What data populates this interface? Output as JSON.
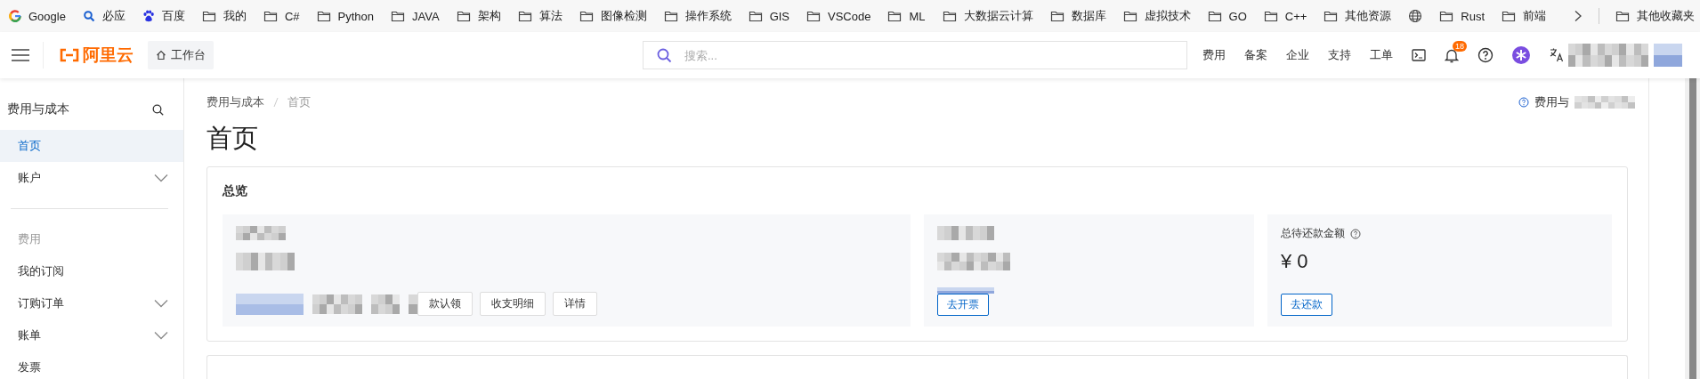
{
  "bookmarks": [
    {
      "label": "Google",
      "kind": "google"
    },
    {
      "label": "必应",
      "kind": "search"
    },
    {
      "label": "百度",
      "kind": "paw"
    },
    {
      "label": "我的",
      "kind": "folder"
    },
    {
      "label": "C#",
      "kind": "folder"
    },
    {
      "label": "Python",
      "kind": "folder"
    },
    {
      "label": "JAVA",
      "kind": "folder"
    },
    {
      "label": "架构",
      "kind": "folder"
    },
    {
      "label": "算法",
      "kind": "folder"
    },
    {
      "label": "图像检测",
      "kind": "folder"
    },
    {
      "label": "操作系统",
      "kind": "folder"
    },
    {
      "label": "GIS",
      "kind": "folder"
    },
    {
      "label": "VSCode",
      "kind": "folder"
    },
    {
      "label": "ML",
      "kind": "folder"
    },
    {
      "label": "大数据云计算",
      "kind": "folder"
    },
    {
      "label": "数据库",
      "kind": "folder"
    },
    {
      "label": "虚拟技术",
      "kind": "folder"
    },
    {
      "label": "GO",
      "kind": "folder"
    },
    {
      "label": "C++",
      "kind": "folder"
    },
    {
      "label": "其他资源",
      "kind": "folder"
    },
    {
      "kind": "globe"
    },
    {
      "label": "Rust",
      "kind": "folder"
    },
    {
      "label": "前端",
      "kind": "folder"
    }
  ],
  "other_bookmarks": {
    "label": "其他收藏夹"
  },
  "topbar": {
    "logo_text": "阿里云",
    "workbench": "工作台",
    "search": {
      "placeholder": "搜索..."
    },
    "links": [
      "费用",
      "备案",
      "企业",
      "支持",
      "工单"
    ],
    "notifications": {
      "count": "18"
    }
  },
  "sidebar": {
    "title": "费用与成本",
    "items": [
      {
        "kind": "link",
        "label": "首页",
        "selected": true
      },
      {
        "kind": "group",
        "label": "账户",
        "selected": false,
        "expanded": false
      },
      {
        "kind": "divider"
      },
      {
        "kind": "section",
        "label": "费用"
      },
      {
        "kind": "link",
        "label": "我的订阅",
        "selected": false
      },
      {
        "kind": "group",
        "label": "订购订单",
        "selected": false,
        "expanded": false
      },
      {
        "kind": "group",
        "label": "账单",
        "selected": false,
        "expanded": false
      },
      {
        "kind": "link",
        "label": "发票",
        "selected": false
      }
    ]
  },
  "main": {
    "breadcrumb": [
      "费用与成本",
      "首页"
    ],
    "help_link": "费用与",
    "title": "首页",
    "overview": {
      "title": "总览",
      "panels": [
        {
          "kind": "account",
          "buttons": [
            "款认领",
            "收支明细",
            "详情"
          ]
        },
        {
          "kind": "invoice",
          "buttons": [
            "去开票"
          ]
        },
        {
          "kind": "debt",
          "label": "总待还款金额",
          "amount": "¥ 0",
          "buttons": [
            "去还款"
          ]
        }
      ]
    }
  }
}
